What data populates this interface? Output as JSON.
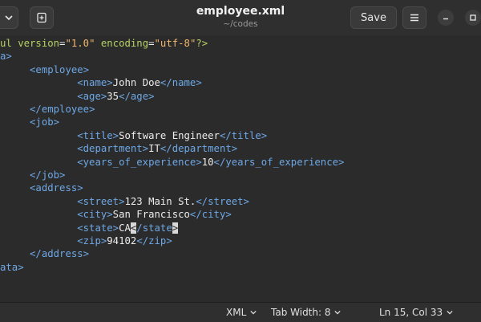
{
  "header": {
    "title": "employee.xml",
    "subtitle": "~/codes",
    "save_label": "Save"
  },
  "editor": {
    "lines": [
      [
        {
          "c": "pi",
          "t": "ul "
        },
        {
          "c": "attr",
          "t": "version"
        },
        {
          "c": "txt",
          "t": "="
        },
        {
          "c": "str",
          "t": "\"1.0\""
        },
        {
          "c": "txt",
          "t": " "
        },
        {
          "c": "attr",
          "t": "encoding"
        },
        {
          "c": "txt",
          "t": "="
        },
        {
          "c": "str",
          "t": "\"utf-8\""
        },
        {
          "c": "pi",
          "t": "?>"
        }
      ],
      [
        {
          "c": "tag",
          "t": "a>"
        }
      ],
      [
        {
          "c": "txt",
          "t": "     "
        },
        {
          "c": "tag",
          "t": "<employee>"
        }
      ],
      [
        {
          "c": "txt",
          "t": "             "
        },
        {
          "c": "tag",
          "t": "<name>"
        },
        {
          "c": "txt",
          "t": "John Doe"
        },
        {
          "c": "tag",
          "t": "</name>"
        }
      ],
      [
        {
          "c": "txt",
          "t": "             "
        },
        {
          "c": "tag",
          "t": "<age>"
        },
        {
          "c": "txt",
          "t": "35"
        },
        {
          "c": "tag",
          "t": "</age>"
        }
      ],
      [
        {
          "c": "txt",
          "t": "     "
        },
        {
          "c": "tag",
          "t": "</employee>"
        }
      ],
      [
        {
          "c": "txt",
          "t": "     "
        },
        {
          "c": "tag",
          "t": "<job>"
        }
      ],
      [
        {
          "c": "txt",
          "t": "             "
        },
        {
          "c": "tag",
          "t": "<title>"
        },
        {
          "c": "txt",
          "t": "Software Engineer"
        },
        {
          "c": "tag",
          "t": "</title>"
        }
      ],
      [
        {
          "c": "txt",
          "t": "             "
        },
        {
          "c": "tag",
          "t": "<department>"
        },
        {
          "c": "txt",
          "t": "IT"
        },
        {
          "c": "tag",
          "t": "</department>"
        }
      ],
      [
        {
          "c": "txt",
          "t": "             "
        },
        {
          "c": "tag",
          "t": "<years_of_experience>"
        },
        {
          "c": "txt",
          "t": "10"
        },
        {
          "c": "tag",
          "t": "</years_of_experience>"
        }
      ],
      [
        {
          "c": "txt",
          "t": "     "
        },
        {
          "c": "tag",
          "t": "</job>"
        }
      ],
      [
        {
          "c": "txt",
          "t": "     "
        },
        {
          "c": "tag",
          "t": "<address>"
        }
      ],
      [
        {
          "c": "txt",
          "t": "             "
        },
        {
          "c": "tag",
          "t": "<street>"
        },
        {
          "c": "txt",
          "t": "123 Main St."
        },
        {
          "c": "tag",
          "t": "</street>"
        }
      ],
      [
        {
          "c": "txt",
          "t": "             "
        },
        {
          "c": "tag",
          "t": "<city>"
        },
        {
          "c": "txt",
          "t": "San Francisco"
        },
        {
          "c": "tag",
          "t": "</city>"
        }
      ],
      [
        {
          "c": "txt",
          "t": "             "
        },
        {
          "c": "tag",
          "t": "<state>"
        },
        {
          "c": "txt",
          "t": "CA"
        },
        {
          "c": "cursor",
          "t": "<"
        },
        {
          "c": "tag",
          "t": "/state"
        },
        {
          "c": "cursor",
          "t": ">"
        }
      ],
      [
        {
          "c": "txt",
          "t": "             "
        },
        {
          "c": "tag",
          "t": "<zip>"
        },
        {
          "c": "txt",
          "t": "94102"
        },
        {
          "c": "tag",
          "t": "</zip>"
        }
      ],
      [
        {
          "c": "txt",
          "t": "     "
        },
        {
          "c": "tag",
          "t": "</address>"
        }
      ],
      [
        {
          "c": "tag",
          "t": "ata>"
        }
      ]
    ]
  },
  "statusbar": {
    "language": "XML",
    "tab_width": "Tab Width: 8",
    "position": "Ln 15, Col 33"
  }
}
